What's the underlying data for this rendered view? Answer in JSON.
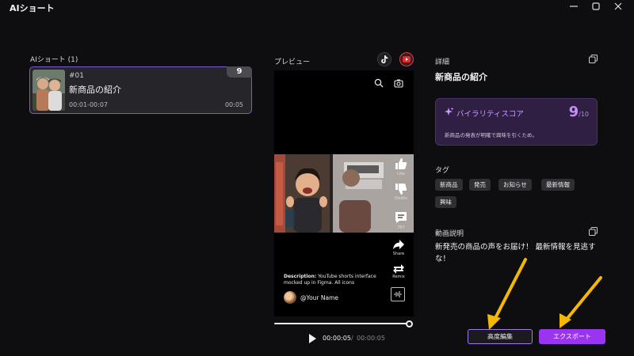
{
  "window": {
    "title": "AIショート"
  },
  "left_panel": {
    "title": "AIショート (1)",
    "clips": [
      {
        "number": "#01",
        "title": "新商品の紹介",
        "range": "00:01-00:07",
        "duration": "00:05",
        "score": "9"
      }
    ]
  },
  "preview": {
    "label": "プレビュー",
    "platforms": [
      "tiktok-icon",
      "youtube-icon"
    ],
    "overlay": {
      "like": "Like",
      "dislike": "Dislike",
      "comments": "767",
      "share": "Share",
      "remix": "Remix",
      "description_label": "Description:",
      "description_text": " YouTube shorts interface mocked up in Figma. All icons",
      "channel": "@Your Name"
    },
    "timeline": {
      "current": "00:00:05",
      "separator": "/",
      "total": "00:00:05",
      "progress": 1.0
    }
  },
  "details": {
    "label": "詳細",
    "title": "新商品の紹介",
    "virality": {
      "label": "バイラリティスコア",
      "score": "9",
      "max": "/10",
      "reason": "新商品の発表が明確で興味を引くため。"
    },
    "tags_label": "タグ",
    "tags": [
      "新商品",
      "発売",
      "お知らせ",
      "最新情報",
      "興味"
    ],
    "description_label": "動画説明",
    "description": "新発売の商品の声をお届け！ 最新情報を見逃すな！"
  },
  "actions": {
    "advanced_edit": "高度編集",
    "export": "エクスポート"
  },
  "colors": {
    "accent": "#9b34f0",
    "selection_border": "#7b5bd6",
    "annotation_arrow": "#f5b800"
  }
}
